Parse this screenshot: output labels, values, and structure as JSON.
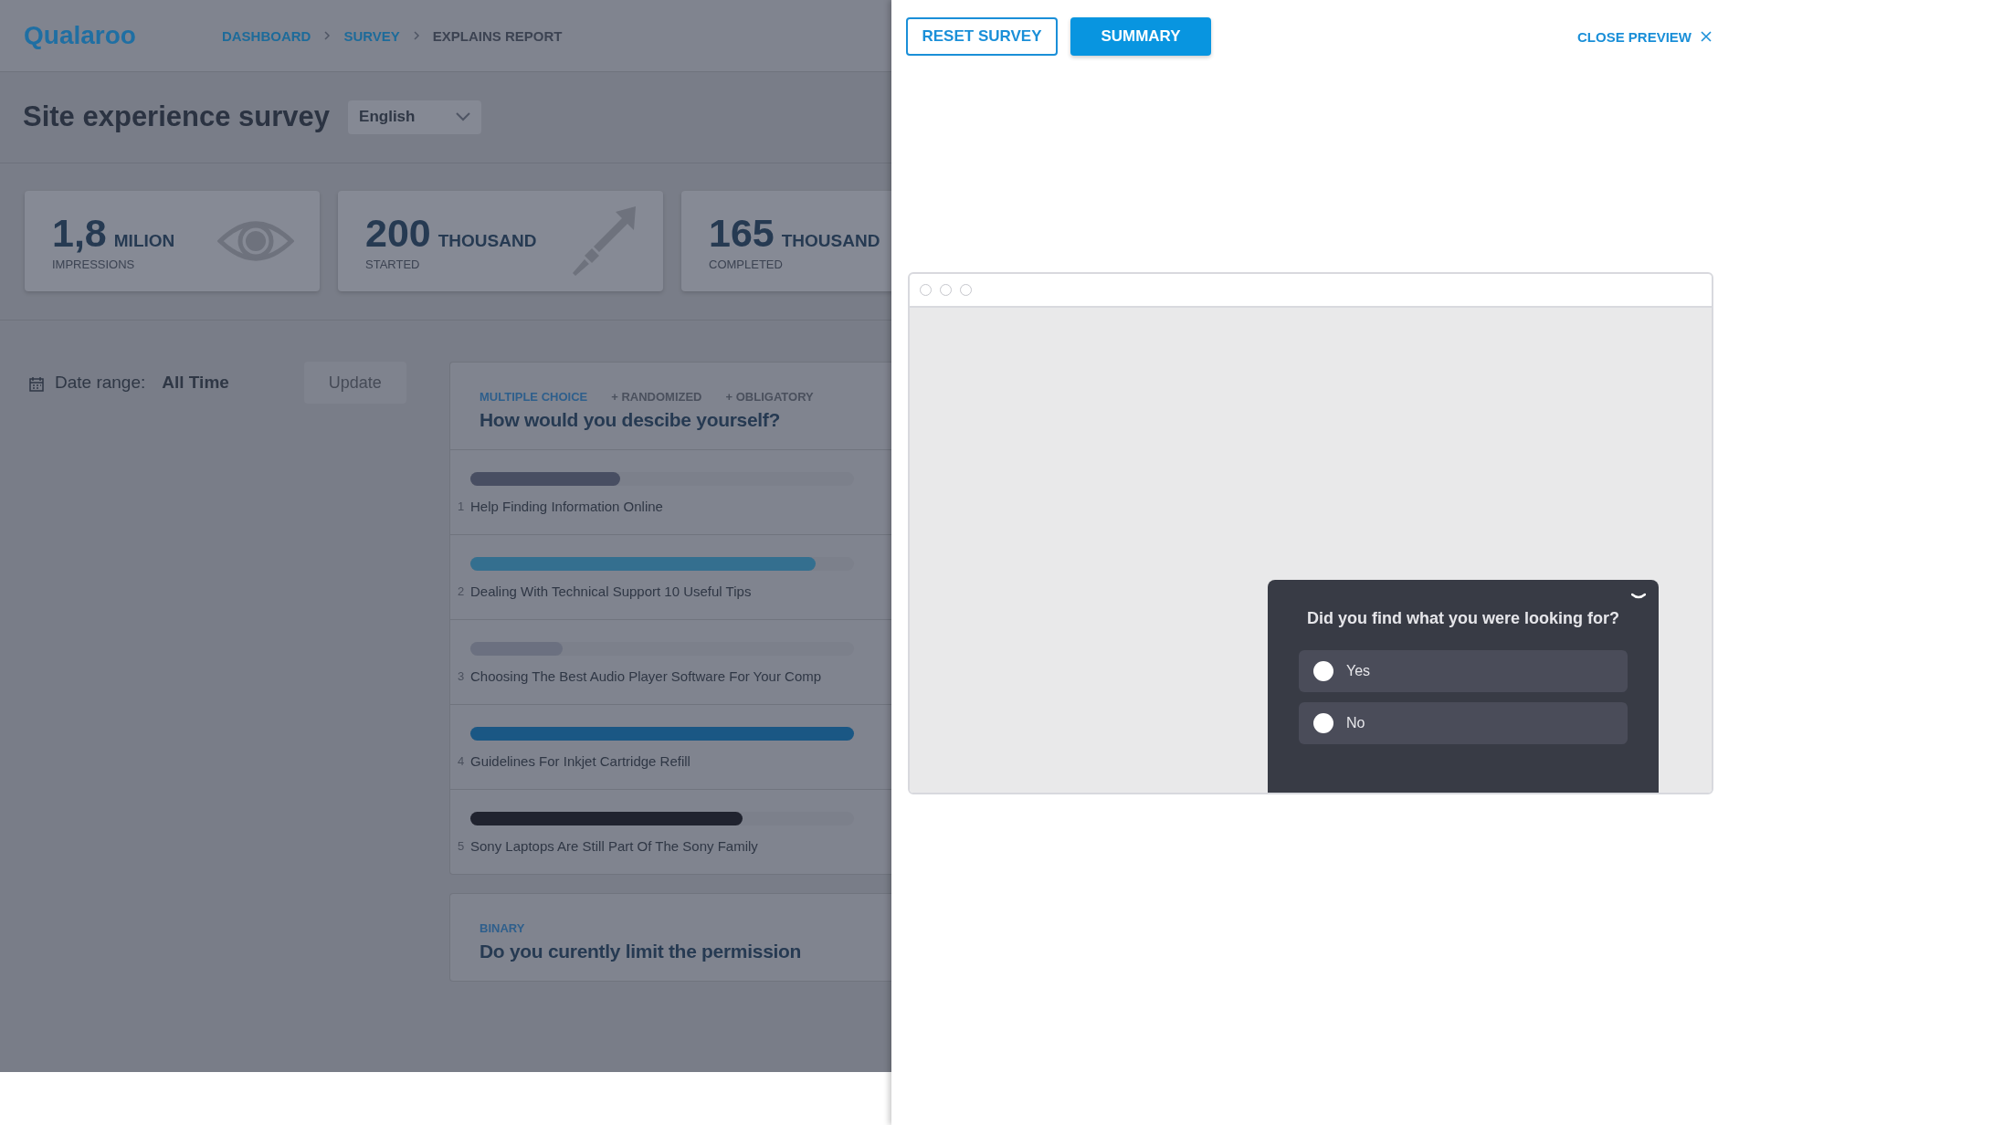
{
  "logo": {
    "text": "Qualaroo"
  },
  "breadcrumbs": [
    {
      "label": "DASHBOARD",
      "kind": "link"
    },
    {
      "label": "SURVEY",
      "kind": "link"
    },
    {
      "label": "EXPLAINS REPORT",
      "kind": "current"
    }
  ],
  "survey": {
    "title": "Site experience survey",
    "language": "English"
  },
  "stats": [
    {
      "value": "1,8",
      "unit": "MILION",
      "label": "IMPRESSIONS",
      "kind": "eye"
    },
    {
      "value": "200",
      "unit": "THOUSAND",
      "label": "STARTED",
      "kind": "rocket"
    },
    {
      "value": "165",
      "unit": "THOUSAND",
      "label": "COMPLETED",
      "kind": "none"
    }
  ],
  "filters": {
    "label": "Date range:",
    "value": "All Time",
    "button": "Update"
  },
  "questions": [
    {
      "type": "MULTIPLE CHOICE",
      "tags": [
        "+ RANDOMIZED",
        "+ OBLIGATORY"
      ],
      "title": "How would you descibe yourself?",
      "answers": [
        {
          "number": "1",
          "text": "Help Finding Information Online",
          "level": 0.39,
          "color": "#484e62"
        },
        {
          "number": "2",
          "text": "Dealing With Technical Support 10 Useful Tips",
          "level": 0.9,
          "color": "#346f8f"
        },
        {
          "number": "3",
          "text": "Choosing The Best Audio Player Software For Your Comp",
          "level": 0.24,
          "color": "#6b7080"
        },
        {
          "number": "4",
          "text": "Guidelines For Inkjet Cartridge Refill",
          "level": 1,
          "color": "#1a5784"
        },
        {
          "number": "5",
          "text": "Sony Laptops Are Still Part Of The Sony Family",
          "level": 0.71,
          "color": "#20232f"
        }
      ]
    },
    {
      "type": "BINARY",
      "title": "Do you curently limit the permission"
    }
  ],
  "preview": {
    "reset_button": "RESET SURVEY",
    "summary_button": "SUMMARY",
    "close": "CLOSE PREVIEW",
    "widget": {
      "question": "Did you find what you were looking for?",
      "options": [
        {
          "label": "Yes",
          "selected": false
        },
        {
          "label": "No",
          "selected": false
        }
      ]
    }
  }
}
